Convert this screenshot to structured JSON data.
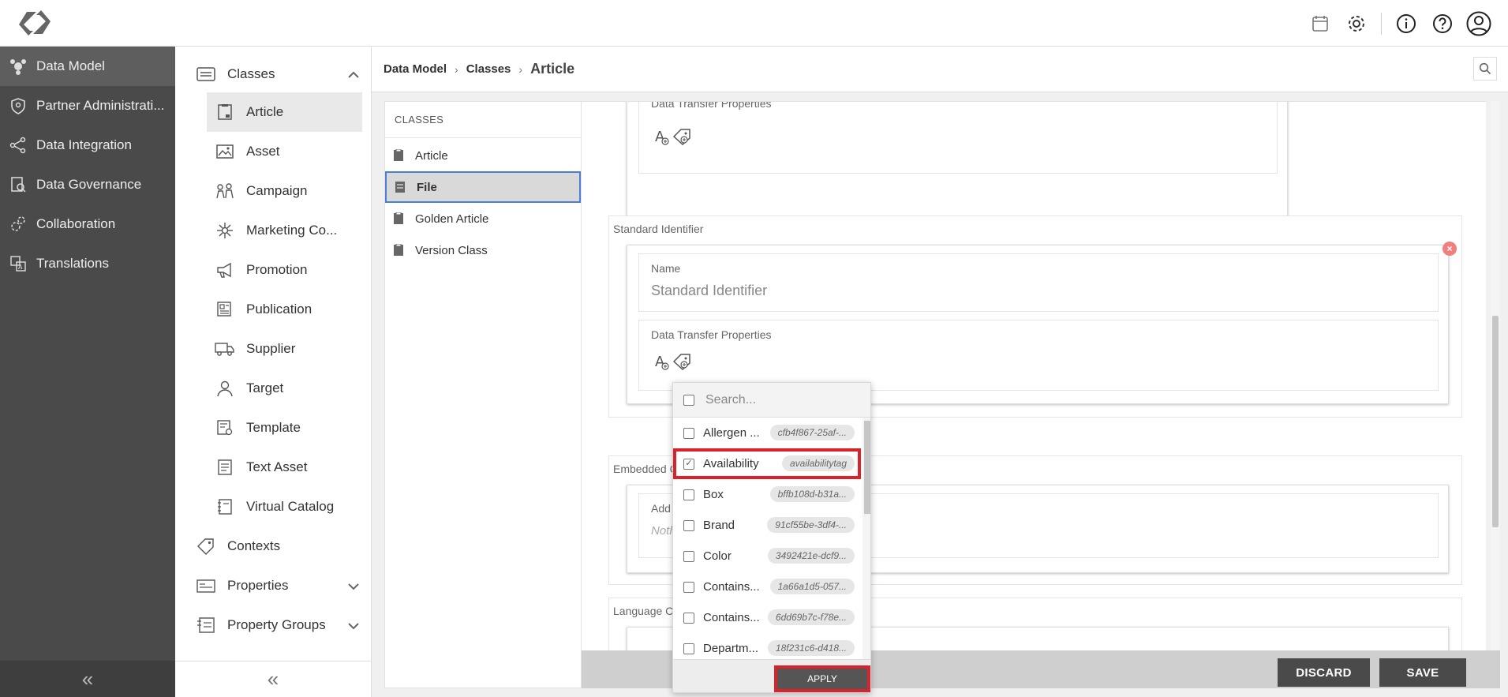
{
  "nav": {
    "items": [
      {
        "label": "Data Model",
        "icon": "data-model-icon",
        "active": true
      },
      {
        "label": "Partner Administrati...",
        "icon": "shield-icon"
      },
      {
        "label": "Data Integration",
        "icon": "share-icon"
      },
      {
        "label": "Data Governance",
        "icon": "governance-icon"
      },
      {
        "label": "Collaboration",
        "icon": "gears-icon"
      },
      {
        "label": "Translations",
        "icon": "translate-icon"
      }
    ]
  },
  "subnav": {
    "classes_label": "Classes",
    "children": [
      {
        "label": "Article",
        "active": true
      },
      {
        "label": "Asset"
      },
      {
        "label": "Campaign"
      },
      {
        "label": "Marketing Co..."
      },
      {
        "label": "Promotion"
      },
      {
        "label": "Publication"
      },
      {
        "label": "Supplier"
      },
      {
        "label": "Target"
      },
      {
        "label": "Template"
      },
      {
        "label": "Text Asset"
      },
      {
        "label": "Virtual Catalog"
      }
    ],
    "contexts_label": "Contexts",
    "properties_label": "Properties",
    "property_groups_label": "Property Groups"
  },
  "breadcrumb": {
    "items": [
      "Data Model",
      "Classes"
    ],
    "current": "Article"
  },
  "classes_panel": {
    "header": "CLASSES",
    "items": [
      {
        "label": "Article"
      },
      {
        "label": "File",
        "active": true
      },
      {
        "label": "Golden Article"
      },
      {
        "label": "Version Class"
      }
    ]
  },
  "detail": {
    "top_card_label": "Data Transfer Properties",
    "standard_identifier": {
      "section_title": "Standard Identifier",
      "name_label": "Name",
      "name_value": "Standard Identifier",
      "dtp_label": "Data Transfer Properties"
    },
    "embedded": {
      "section_title": "Embedded C",
      "add_label": "Add c",
      "empty_text": "Noth"
    },
    "language": {
      "section_title": "Language C"
    }
  },
  "dropdown": {
    "search_placeholder": "Search...",
    "options": [
      {
        "label": "Allergen ...",
        "tag": "cfb4f867-25af-...",
        "checked": false
      },
      {
        "label": "Availability",
        "tag": "availabilitytag",
        "checked": true
      },
      {
        "label": "Box",
        "tag": "bffb108d-b31a...",
        "checked": false
      },
      {
        "label": "Brand",
        "tag": "91cf55be-3df4-...",
        "checked": false
      },
      {
        "label": "Color",
        "tag": "3492421e-dcf9...",
        "checked": false
      },
      {
        "label": "Contains...",
        "tag": "1a66a1d5-057...",
        "checked": false
      },
      {
        "label": "Contains...",
        "tag": "6dd69b7c-f78e...",
        "checked": false
      },
      {
        "label": "Departm...",
        "tag": "18f231c6-d418...",
        "checked": false
      }
    ],
    "apply_label": "APPLY"
  },
  "footer": {
    "discard_label": "DISCARD",
    "save_label": "SAVE"
  }
}
